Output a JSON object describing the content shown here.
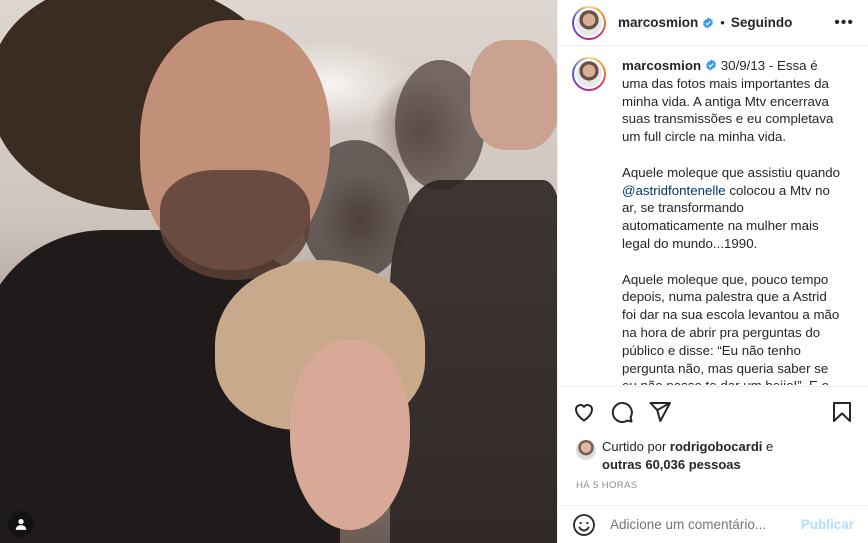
{
  "post": {
    "photo_icon": "person-tag-icon"
  },
  "header": {
    "username": "marcosmion",
    "separator": "•",
    "follow_status": "Seguindo",
    "more_label": "•••"
  },
  "caption": {
    "username": "marcosmion",
    "paragraph1": " 30/9/13 - Essa é uma das fotos mais importantes da minha vida. A antiga Mtv encerrava suas transmissões e eu completava um full circle na minha vida.",
    "paragraph2_before": "Aquele moleque que assistiu quando ",
    "mention": "@astridfontenelle",
    "paragraph2_after": " colocou a Mtv no ar, se transformando automaticamente na mulher mais legal do mundo...1990.",
    "paragraph3": "Aquele moleque que, pouco tempo depois, numa palestra que a Astrid foi dar na sua escola levantou a mão na hora de abrir pra perguntas do público e disse: “Eu não tenho pergunta não, mas queria saber se eu não posso te dar um beijo!”. E o"
  },
  "actions": {
    "icons": [
      "heart-icon",
      "comment-icon",
      "share-icon",
      "save-icon"
    ]
  },
  "likes": {
    "prefix": "Curtido por ",
    "user": "rodrigobocardi",
    "middle": " e ",
    "others": "outras 60,036 pessoas"
  },
  "timestamp": "HÁ 5 HORAS",
  "comment": {
    "placeholder": "Adicione um comentário...",
    "publish_label": "Publicar"
  },
  "colors": {
    "verified": "#3897f0",
    "mention": "#00376b",
    "publish_disabled": "#b2dffc",
    "muted_text": "#8e8e8e"
  }
}
